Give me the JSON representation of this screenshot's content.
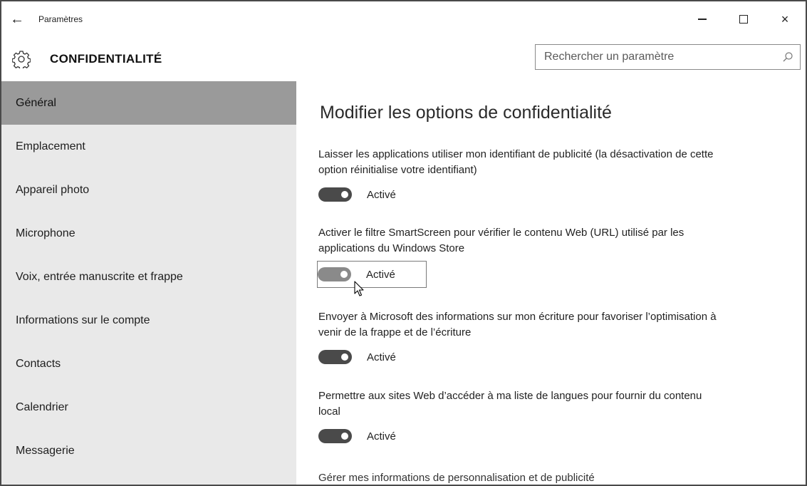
{
  "window": {
    "app_title": "Paramètres",
    "back_glyph": "←",
    "close_glyph": "×"
  },
  "header": {
    "section_title": "CONFIDENTIALITÉ",
    "search_placeholder": "Rechercher un paramètre",
    "icon": "gear-icon"
  },
  "sidebar": {
    "items": [
      {
        "label": "Général",
        "selected": true
      },
      {
        "label": "Emplacement"
      },
      {
        "label": "Appareil photo"
      },
      {
        "label": "Microphone"
      },
      {
        "label": "Voix, entrée manuscrite et frappe"
      },
      {
        "label": "Informations sur le compte"
      },
      {
        "label": "Contacts"
      },
      {
        "label": "Calendrier"
      },
      {
        "label": "Messagerie"
      }
    ]
  },
  "main": {
    "title": "Modifier les options de confidentialité",
    "options": [
      {
        "text": "Laisser les applications utiliser mon identifiant de publicité (la désactivation de cette option réinitialise votre identifiant)",
        "state": "Activé",
        "on": true
      },
      {
        "text": "Activer le filtre SmartScreen pour vérifier le contenu Web (URL) utilisé par les applications du Windows Store",
        "state": "Activé",
        "on": true
      },
      {
        "text": "Envoyer à Microsoft des informations sur mon écriture pour favoriser l’optimisation à venir de la frappe et de l’écriture",
        "state": "Activé",
        "on": true
      },
      {
        "text": "Permettre aux sites Web d’accéder à ma liste de langues pour fournir du contenu local",
        "state": "Activé",
        "on": true
      }
    ],
    "link_text": "Gérer mes informations de personnalisation et de publicité"
  },
  "colors": {
    "sidebar_bg": "#e9e9e9",
    "selected_bg": "#9a9a9a",
    "toggle_on": "#4a4a4a",
    "toggle_hover": "#8a8a8a"
  }
}
